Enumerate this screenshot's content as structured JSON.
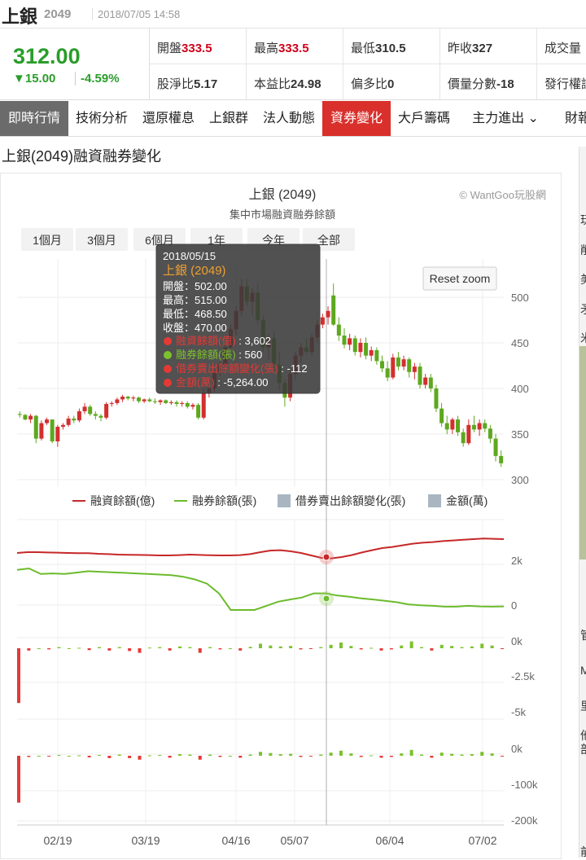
{
  "header": {
    "name": "上銀",
    "code": "2049",
    "time": "2018/07/05 14:58"
  },
  "quote": {
    "price": "312.00",
    "change": "▼15.00",
    "change_pct": "-4.59%",
    "row1": [
      {
        "label": "開盤",
        "value": "333.5",
        "color": "red"
      },
      {
        "label": "最高",
        "value": "333.5",
        "color": "red"
      },
      {
        "label": "最低",
        "value": "310.5",
        "color": "dark"
      },
      {
        "label": "昨收",
        "value": "327",
        "color": "dark"
      },
      {
        "label": "成交量",
        "value": "",
        "color": "dark"
      }
    ],
    "row2": [
      {
        "label": "股淨比",
        "value": "5.17",
        "color": "dark"
      },
      {
        "label": "本益比",
        "value": "24.98",
        "color": "dark"
      },
      {
        "label": "偏多比",
        "value": "0",
        "color": "dark"
      },
      {
        "label": "價量分數",
        "value": "-18",
        "color": "dark"
      },
      {
        "label": "發行權證",
        "value": "",
        "color": "dark"
      }
    ]
  },
  "tabs": [
    "即時行情",
    "技術分析",
    "還原權息",
    "上銀群",
    "法人動態",
    "資券變化",
    "大戶籌碼",
    "主力進出 ⌄",
    "財報"
  ],
  "active_tab": "資券變化",
  "page_title": "上銀(2049)融資融券變化",
  "chart": {
    "title": "上銀 (2049)",
    "subtitle": "集中市場融資融券餘額",
    "credit": "© WantGoo玩股網",
    "range_buttons": [
      "1個月",
      "3個月",
      "6個月",
      "1年",
      "今年",
      "全部"
    ],
    "reset_zoom": "Reset zoom",
    "legend": [
      {
        "name": "融資餘額(億)",
        "color": "#c62828",
        "kind": "line"
      },
      {
        "name": "融券餘額(張)",
        "color": "#6cbb2c",
        "kind": "line"
      },
      {
        "name": "借券賣出餘額變化(張)",
        "color": "#a9b6c2",
        "kind": "box"
      },
      {
        "name": "金額(萬)",
        "color": "#a9b6c2",
        "kind": "box"
      }
    ],
    "tooltip": {
      "date": "2018/05/15",
      "name": "上銀 (2049)",
      "ohlc": [
        {
          "label": "開盤",
          "value": "502.00"
        },
        {
          "label": "最高",
          "value": "515.00"
        },
        {
          "label": "最低",
          "value": "468.50"
        },
        {
          "label": "收盤",
          "value": "470.00"
        }
      ],
      "series": [
        {
          "label": "融資餘額(億)",
          "value": "3,602",
          "color": "#e53935"
        },
        {
          "label": "融券餘額(張)",
          "value": "560",
          "color": "#7cc22c"
        },
        {
          "label": "借券賣出餘額變化(張)",
          "value": "-112",
          "color": "#e53935"
        },
        {
          "label": "金額(萬)",
          "value": "-5,264.00",
          "color": "#e53935"
        }
      ]
    }
  },
  "chart_data": {
    "type": "candlestick+line+bar",
    "x_ticks": [
      "02/19",
      "03/19",
      "04/16",
      "05/07",
      "06/04",
      "07/02"
    ],
    "price_axis": {
      "ticks": [
        "500",
        "450",
        "400",
        "350",
        "300"
      ],
      "range": [
        300,
        500
      ]
    },
    "balance_axis": {
      "ticks": [
        "2k",
        "0"
      ]
    },
    "lending_axis": {
      "ticks": [
        "0k",
        "-2.5k",
        "-5k"
      ]
    },
    "amount_axis": {
      "ticks": [
        "0k",
        "-100k",
        "-200k"
      ]
    },
    "candles": [
      [
        372,
        375,
        368,
        371
      ],
      [
        371,
        372,
        365,
        366
      ],
      [
        366,
        372,
        362,
        370
      ],
      [
        370,
        371,
        340,
        345
      ],
      [
        345,
        365,
        343,
        362
      ],
      [
        362,
        368,
        360,
        366
      ],
      [
        366,
        366,
        340,
        342
      ],
      [
        342,
        360,
        336,
        358
      ],
      [
        358,
        362,
        355,
        360
      ],
      [
        360,
        370,
        358,
        367
      ],
      [
        367,
        370,
        362,
        365
      ],
      [
        365,
        378,
        363,
        375
      ],
      [
        375,
        384,
        372,
        380
      ],
      [
        380,
        382,
        370,
        372
      ],
      [
        372,
        375,
        366,
        370
      ],
      [
        370,
        372,
        364,
        368
      ],
      [
        368,
        385,
        366,
        383
      ],
      [
        383,
        386,
        380,
        384
      ],
      [
        384,
        390,
        382,
        388
      ],
      [
        388,
        393,
        385,
        391
      ],
      [
        391,
        392,
        387,
        389
      ],
      [
        389,
        392,
        386,
        390
      ],
      [
        390,
        391,
        384,
        386
      ],
      [
        386,
        389,
        384,
        388
      ],
      [
        388,
        390,
        385,
        386
      ],
      [
        386,
        389,
        383,
        385
      ],
      [
        385,
        388,
        382,
        387
      ],
      [
        387,
        388,
        383,
        384
      ],
      [
        384,
        387,
        382,
        385
      ],
      [
        385,
        387,
        380,
        383
      ],
      [
        383,
        386,
        380,
        384
      ],
      [
        384,
        386,
        378,
        380
      ],
      [
        380,
        384,
        377,
        382
      ],
      [
        382,
        384,
        366,
        368
      ],
      [
        368,
        400,
        366,
        395
      ],
      [
        395,
        405,
        390,
        400
      ],
      [
        400,
        420,
        396,
        418
      ],
      [
        418,
        430,
        414,
        426
      ],
      [
        426,
        448,
        420,
        445
      ],
      [
        445,
        470,
        440,
        465
      ],
      [
        465,
        490,
        458,
        485
      ],
      [
        485,
        520,
        480,
        512
      ],
      [
        512,
        520,
        490,
        495
      ],
      [
        495,
        510,
        480,
        505
      ],
      [
        505,
        515,
        470,
        475
      ],
      [
        475,
        480,
        440,
        445
      ],
      [
        445,
        460,
        432,
        455
      ],
      [
        455,
        462,
        420,
        426
      ],
      [
        426,
        440,
        398,
        406
      ],
      [
        406,
        410,
        380,
        390
      ],
      [
        390,
        420,
        386,
        416
      ],
      [
        416,
        440,
        410,
        436
      ],
      [
        436,
        450,
        428,
        445
      ],
      [
        445,
        455,
        438,
        440
      ],
      [
        440,
        460,
        436,
        456
      ],
      [
        456,
        475,
        450,
        470
      ],
      [
        470,
        482,
        466,
        478
      ],
      [
        478,
        490,
        470,
        485
      ],
      [
        502,
        515,
        468.5,
        470
      ],
      [
        470,
        478,
        452,
        458
      ],
      [
        458,
        466,
        444,
        448
      ],
      [
        448,
        460,
        442,
        455
      ],
      [
        455,
        458,
        436,
        440
      ],
      [
        440,
        455,
        434,
        450
      ],
      [
        450,
        456,
        432,
        436
      ],
      [
        436,
        446,
        430,
        442
      ],
      [
        442,
        445,
        426,
        430
      ],
      [
        430,
        436,
        418,
        422
      ],
      [
        422,
        430,
        408,
        412
      ],
      [
        412,
        438,
        410,
        434
      ],
      [
        434,
        440,
        420,
        424
      ],
      [
        424,
        436,
        420,
        432
      ],
      [
        432,
        434,
        412,
        418
      ],
      [
        418,
        428,
        410,
        424
      ],
      [
        424,
        428,
        400,
        404
      ],
      [
        404,
        416,
        400,
        412
      ],
      [
        412,
        416,
        396,
        400
      ],
      [
        400,
        404,
        374,
        378
      ],
      [
        378,
        384,
        358,
        362
      ],
      [
        362,
        370,
        350,
        355
      ],
      [
        355,
        368,
        350,
        366
      ],
      [
        366,
        370,
        348,
        352
      ],
      [
        352,
        356,
        336,
        340
      ],
      [
        340,
        366,
        338,
        360
      ],
      [
        360,
        370,
        352,
        355
      ],
      [
        355,
        366,
        348,
        362
      ],
      [
        362,
        366,
        352,
        356
      ],
      [
        356,
        360,
        340,
        345
      ],
      [
        345,
        350,
        320,
        326
      ],
      [
        326,
        332,
        314,
        318
      ]
    ],
    "margin_balance": [
      0.45,
      0.5,
      0.5,
      0.48,
      0.47,
      0.45,
      0.44,
      0.44,
      0.4,
      0.38,
      0.35,
      0.34,
      0.33,
      0.32,
      0.3,
      0.3,
      0.32,
      0.35,
      0.33,
      0.31,
      0.3,
      0.3,
      0.32,
      0.38,
      0.5,
      0.6,
      0.62,
      0.55,
      0.45,
      0.3,
      0.15,
      0.12,
      0.2,
      0.32,
      0.48,
      0.62,
      0.75,
      0.82,
      0.92,
      1.02,
      1.08,
      1.12,
      1.18,
      1.22,
      1.26,
      1.3,
      1.34,
      1.32,
      1.3
    ],
    "short_balance": [
      1.45,
      1.5,
      1.3,
      1.32,
      1.3,
      1.35,
      1.4,
      1.38,
      1.36,
      1.34,
      1.32,
      1.3,
      1.28,
      1.26,
      1.2,
      1.1,
      0.95,
      0.6,
      0.0,
      0.0,
      0.0,
      0.15,
      0.3,
      0.38,
      0.45,
      0.6,
      0.6,
      0.52,
      0.48,
      0.42,
      0.38,
      0.33,
      0.28,
      0.2,
      0.17,
      0.15,
      0.12,
      0.12,
      0.15,
      0.13,
      0.12,
      0.13
    ],
    "lending_change": [
      -2.4,
      -0.1,
      0,
      -0.05,
      0.05,
      0,
      0.02,
      -0.08,
      0.05,
      -0.1,
      0.05,
      -0.12,
      -0.2,
      0.03,
      0.05,
      -0.1,
      0.08,
      0.05,
      -0.2,
      0.05,
      -0.05,
      0,
      -0.1,
      0.06,
      0.2,
      0.12,
      0.08,
      0.1,
      -0.05,
      -0.03,
      0.05,
      0.15,
      0.25,
      0.1,
      -0.05,
      0.02,
      -0.1,
      -0.05,
      0.12,
      0.3,
      0.05,
      -0.1,
      0.15,
      0.1,
      0.05,
      0.08,
      0.2,
      0.12,
      -0.02
    ],
    "amount": [
      -120,
      -3,
      0,
      -2,
      2,
      0,
      1,
      -4,
      2,
      -6,
      3,
      -6,
      -10,
      1,
      2,
      -5,
      4,
      3,
      -10,
      3,
      -3,
      0,
      -5,
      3,
      10,
      7,
      4,
      5,
      -3,
      -2,
      3,
      8,
      13,
      6,
      -3,
      1,
      -5,
      -3,
      6,
      15,
      3,
      -5,
      8,
      5,
      3,
      4,
      10,
      6,
      -1
    ]
  },
  "side": {
    "chars": [
      "玩",
      "削",
      "美",
      "矛",
      "米",
      "管",
      "M",
      "里",
      "他",
      "部",
      "前"
    ]
  }
}
